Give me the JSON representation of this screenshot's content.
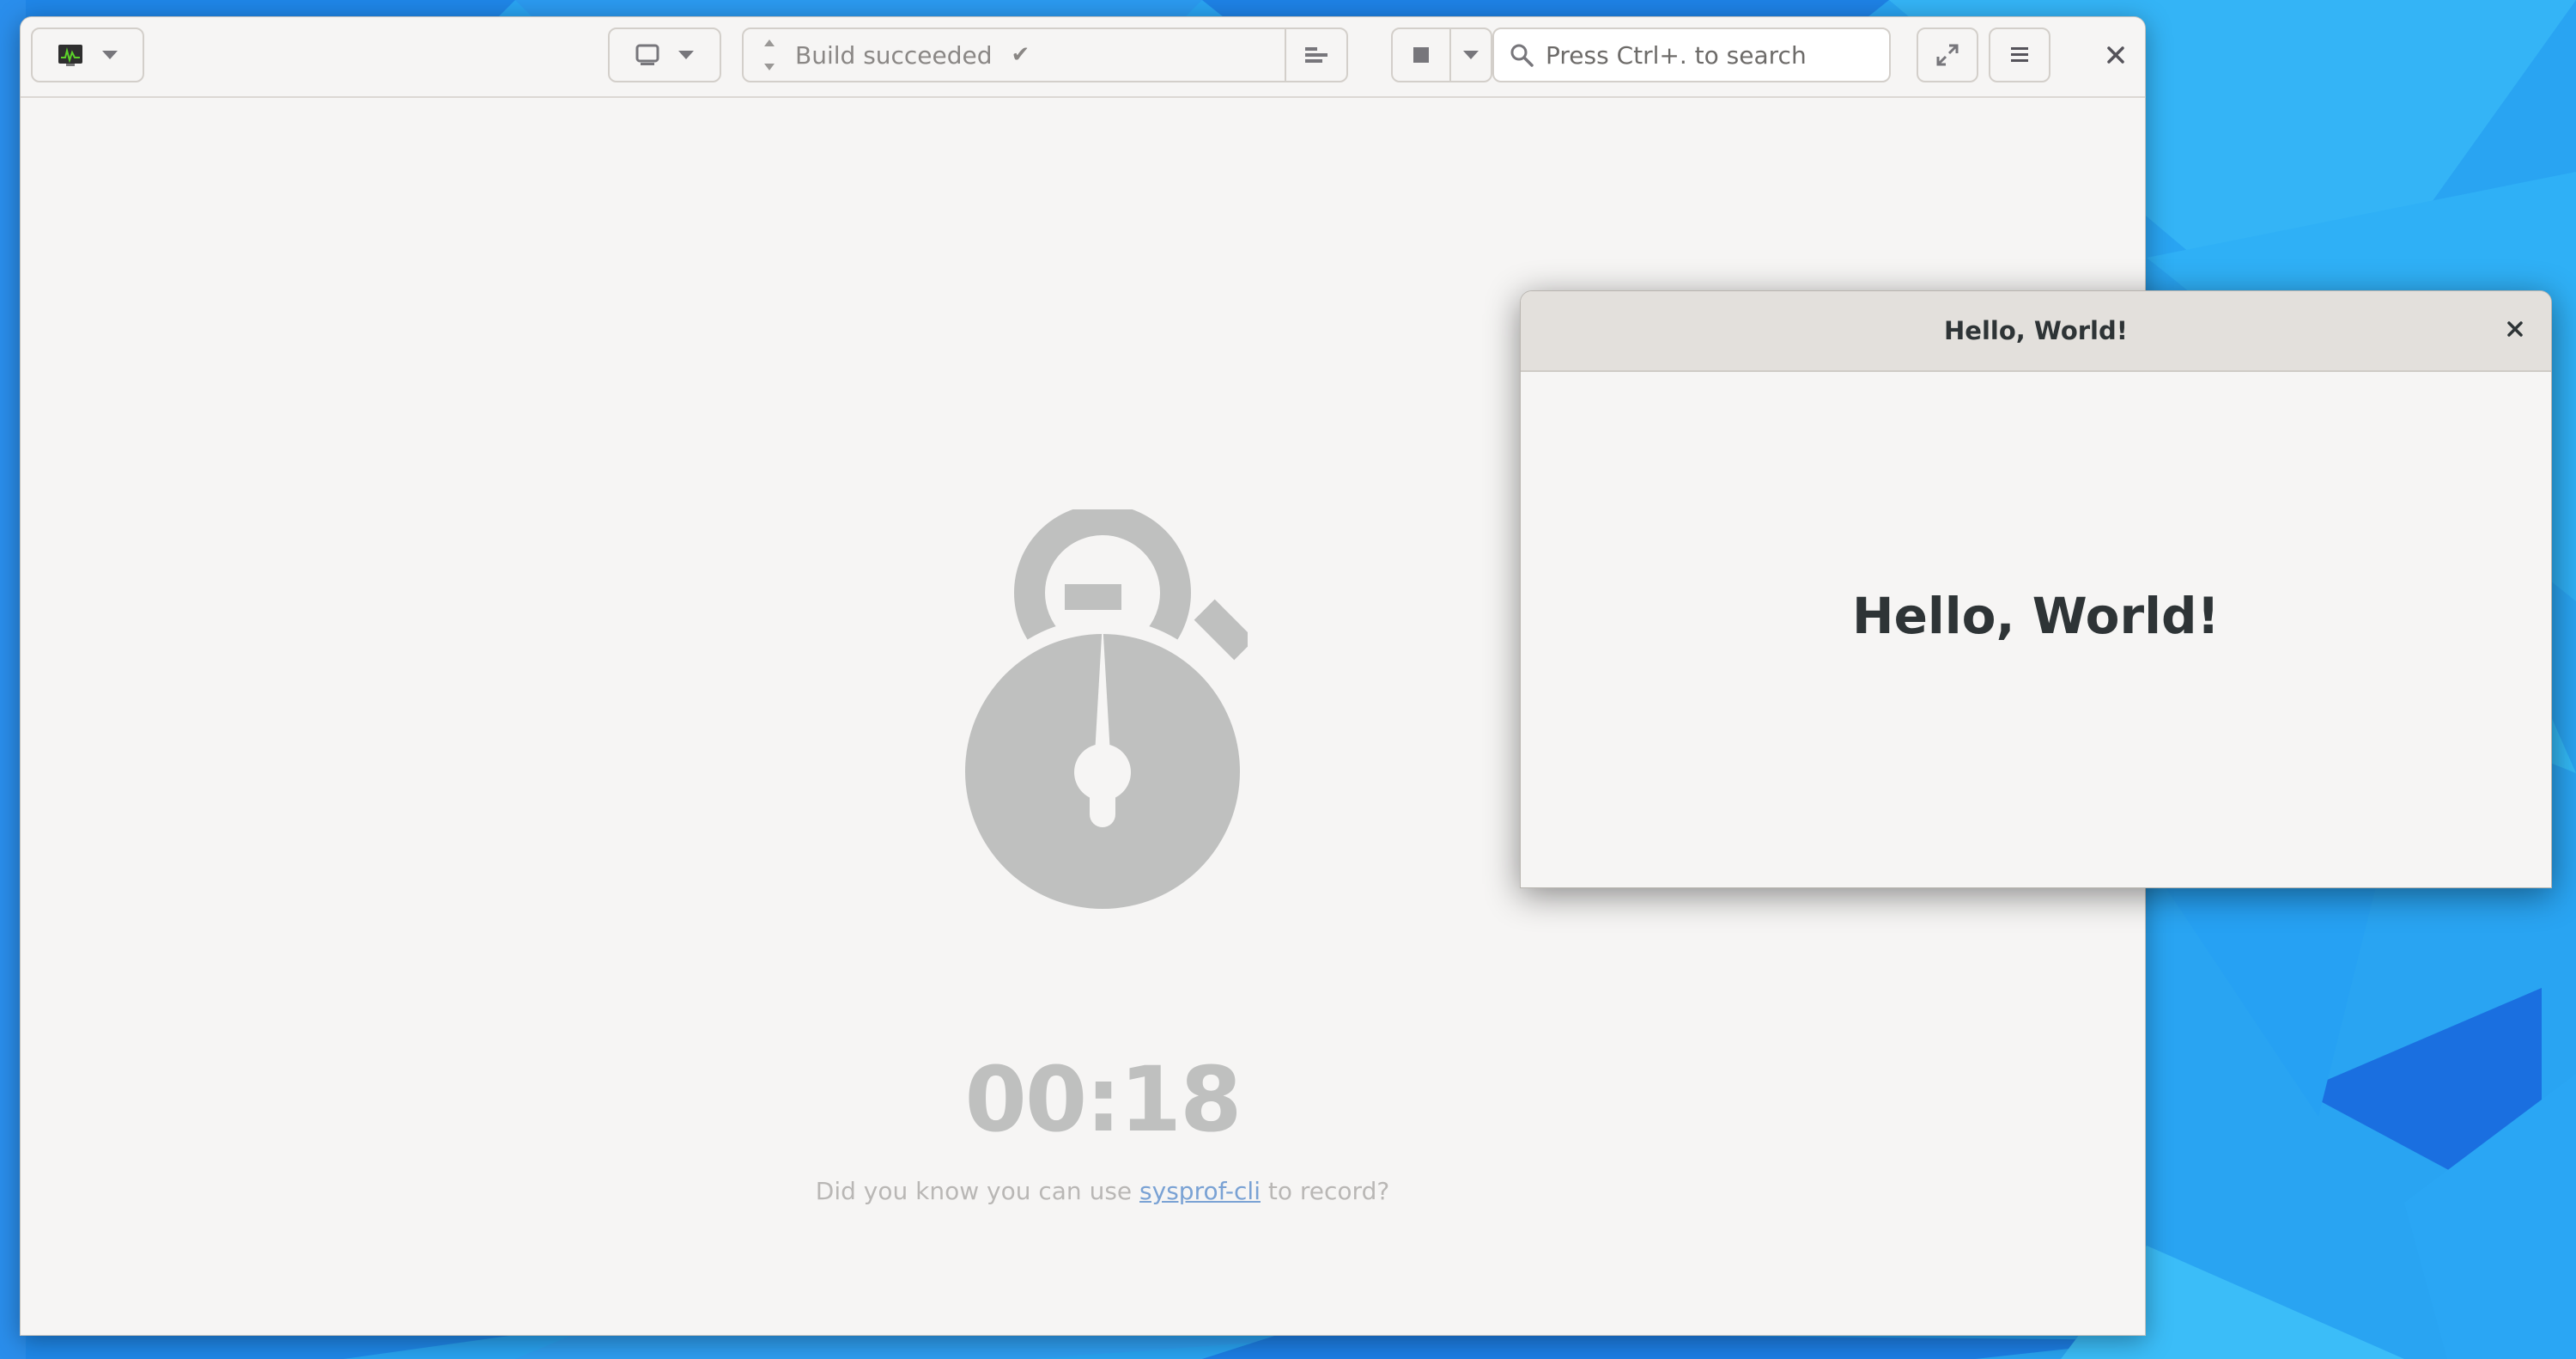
{
  "builder": {
    "build_status": "Build succeeded",
    "search_placeholder": "Press Ctrl+. to search",
    "timer": "00:18",
    "tip": {
      "prefix": "Did you know you can use ",
      "link": "sysprof-cli",
      "suffix": " to record?"
    }
  },
  "hello_window": {
    "title": "Hello, World!",
    "label": "Hello, World!"
  },
  "icons": {
    "profiler": "system-monitor-icon",
    "device": "monitor-icon",
    "build_progress": "build-progress-icon",
    "stop": "stop-icon",
    "search": "search-icon",
    "fullscreen": "fullscreen-icon",
    "menu": "hamburger-menu-icon",
    "close": "close-icon",
    "timer": "stopwatch-icon"
  },
  "colors": {
    "wallpaper": "#2a97ee",
    "link": "#7aa2d4",
    "timer": "#bfc0bf"
  }
}
